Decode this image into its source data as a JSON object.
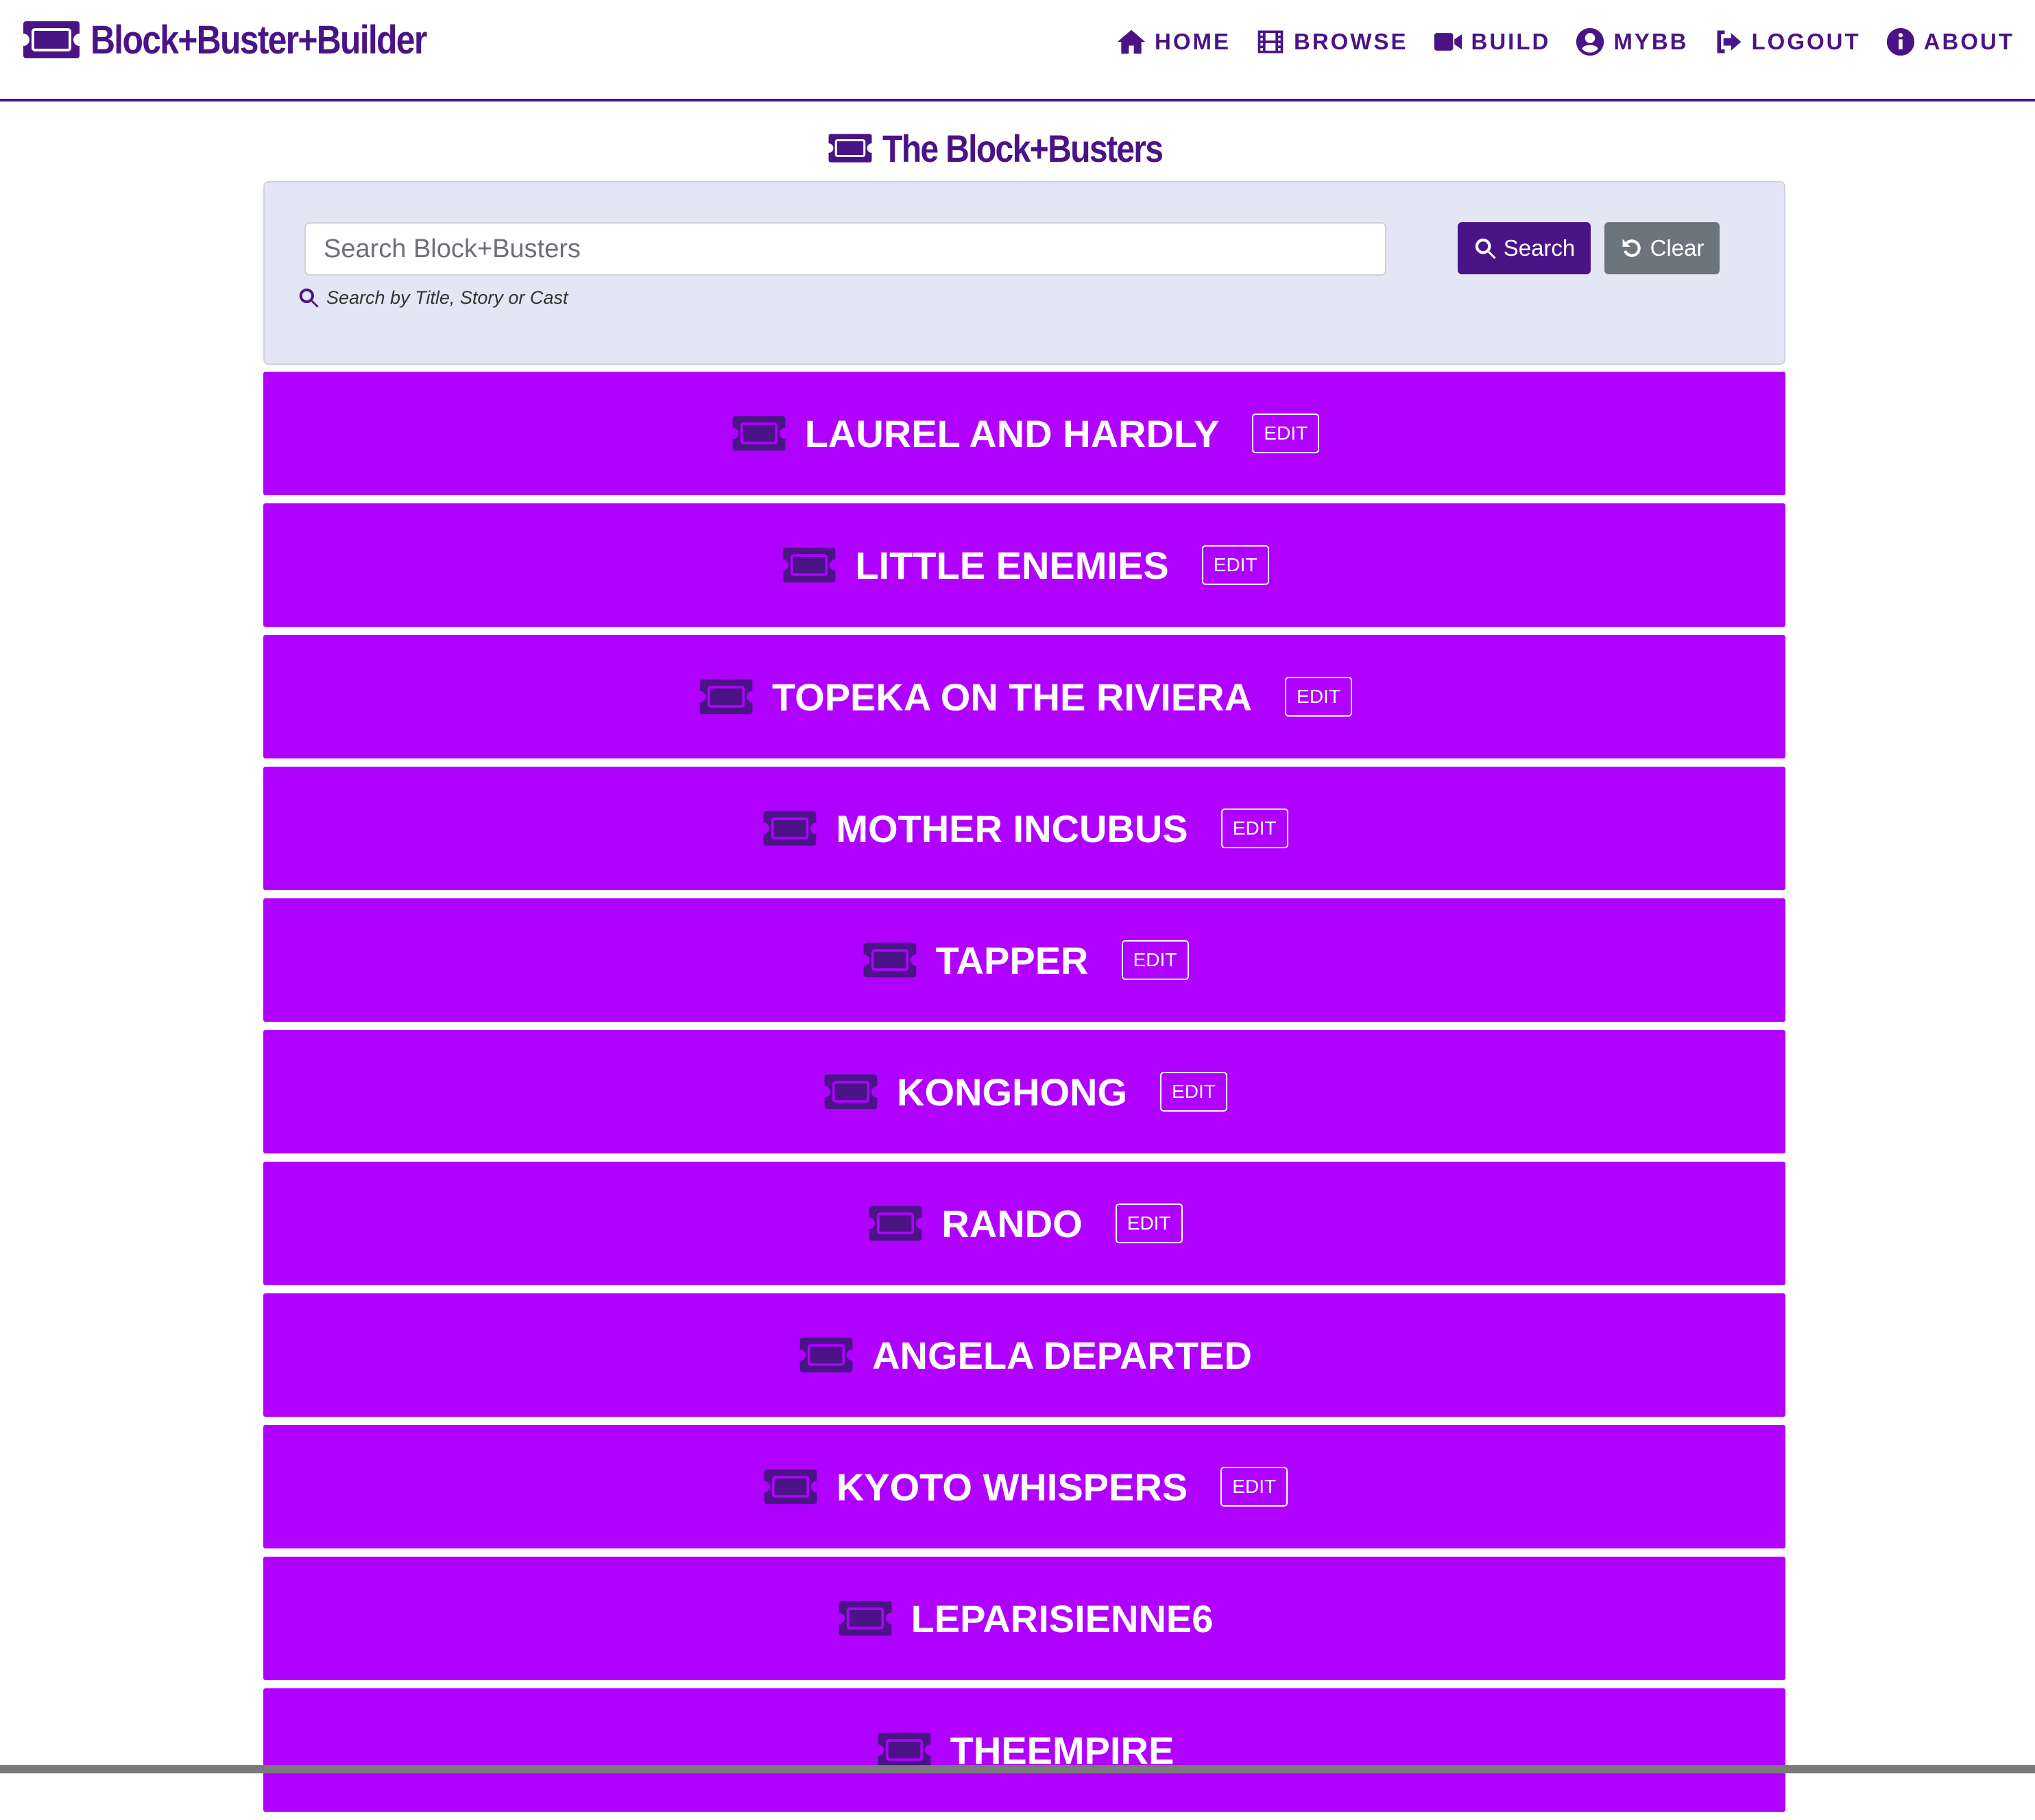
{
  "brand": {
    "name": "Block+Buster+Builder",
    "icon": "ticket-icon"
  },
  "nav": [
    {
      "label": "HOME",
      "icon": "home-icon"
    },
    {
      "label": "BROWSE",
      "icon": "film-icon"
    },
    {
      "label": "BUILD",
      "icon": "video-camera-icon"
    },
    {
      "label": "MYBB",
      "icon": "user-circle-icon"
    },
    {
      "label": "LOGOUT",
      "icon": "sign-out-icon"
    },
    {
      "label": "ABOUT",
      "icon": "info-circle-icon"
    }
  ],
  "page": {
    "title": "The Block+Busters"
  },
  "search": {
    "placeholder": "Search Block+Busters",
    "value": "",
    "hint": "Search by Title, Story or Cast",
    "search_label": "Search",
    "clear_label": "Clear"
  },
  "edit_label": "EDIT",
  "movies": [
    {
      "title": "LAUREL AND HARDLY",
      "editable": true
    },
    {
      "title": "LITTLE ENEMIES",
      "editable": true
    },
    {
      "title": "TOPEKA ON THE RIVIERA",
      "editable": true
    },
    {
      "title": "MOTHER INCUBUS",
      "editable": true
    },
    {
      "title": "TAPPER",
      "editable": true
    },
    {
      "title": "KONGHONG",
      "editable": true
    },
    {
      "title": "RANDO",
      "editable": true
    },
    {
      "title": "ANGELA DEPARTED",
      "editable": false
    },
    {
      "title": "KYOTO WHISPERS",
      "editable": true
    },
    {
      "title": "LEPARISIENNE6",
      "editable": false
    },
    {
      "title": "THEEMPIRE",
      "editable": false
    }
  ],
  "colors": {
    "brand": "#4a1486",
    "card": "#b000ff",
    "panel": "#e5e6f5",
    "clear_button": "#6c757d"
  }
}
